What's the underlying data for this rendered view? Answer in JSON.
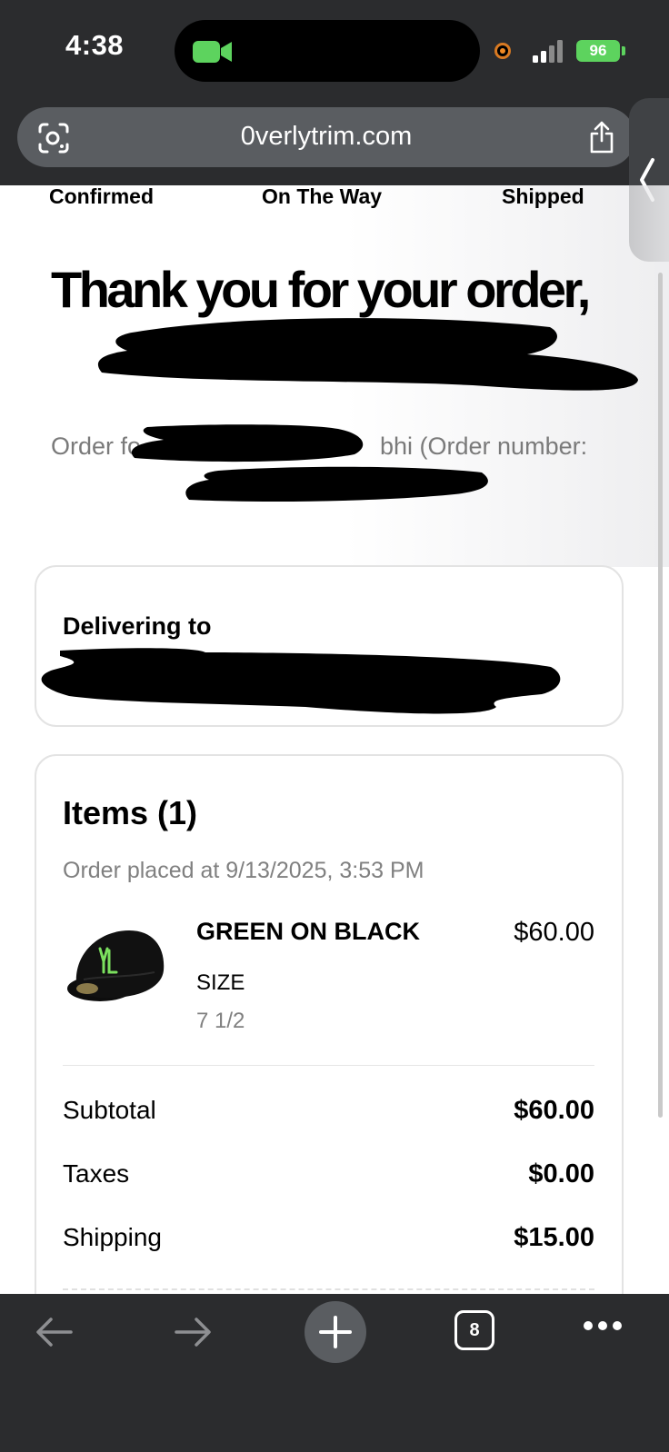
{
  "status_bar": {
    "time": "4:38",
    "battery": "96"
  },
  "browser": {
    "url": "0verlytrim.com",
    "tab_count": "8"
  },
  "progress_steps": [
    "Confirmed",
    "On The Way",
    "Shipped"
  ],
  "header": {
    "title": "Thank you for your order,",
    "order_line_prefix": "Order fo",
    "order_line_suffix": "bhi (Order number:"
  },
  "delivery": {
    "title": "Delivering to"
  },
  "items": {
    "title": "Items (1)",
    "placed": "Order placed at 9/13/2025, 3:53 PM",
    "products": [
      {
        "name": "GREEN ON BLACK",
        "price": "$60.00",
        "option_label": "SIZE",
        "option_value": "7 1/2"
      }
    ]
  },
  "summary": [
    {
      "label": "Subtotal",
      "value": "$60.00"
    },
    {
      "label": "Taxes",
      "value": "$0.00"
    },
    {
      "label": "Shipping",
      "value": "$15.00"
    }
  ],
  "colors": {
    "chrome": "#2b2c2e",
    "urlbar": "#5a5d61",
    "battery": "#5dd35e",
    "facetime": "#5dd35e",
    "hat_logo": "#7be05e",
    "muted_text": "#808080"
  }
}
